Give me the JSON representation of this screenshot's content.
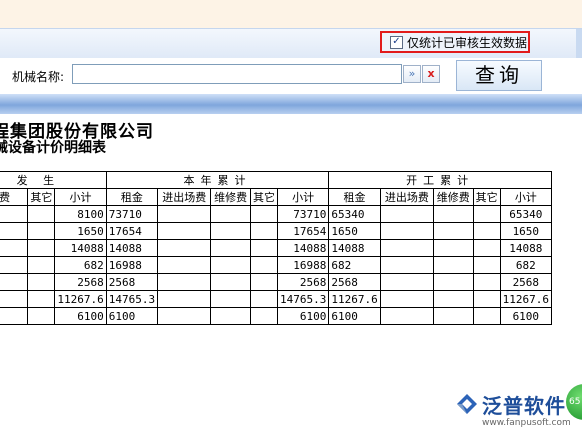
{
  "filter": {
    "verified_only_label": "仅统计已审核生效数据",
    "verified_only_checked": true,
    "machine_name_label": "机械名称:",
    "machine_name_value": "",
    "more_button": "»",
    "clear_button": "x",
    "query_button": "查询"
  },
  "report": {
    "company_title": "程集团股份有限公司",
    "report_title": "械设备计价明细表",
    "groups": {
      "current": "发 生",
      "year": "本年累计",
      "start": "开工累计"
    },
    "columns": {
      "repair": "修费",
      "other": "其它",
      "subtotal": "小计",
      "rent": "租金",
      "in_out": "进出场费",
      "repair_fee": "维修费"
    },
    "rows": [
      {
        "cur_subtotal": "8100",
        "year_rent": "73710",
        "year_subtotal": "73710",
        "start_rent": "65340",
        "start_subtotal": "65340"
      },
      {
        "cur_subtotal": "1650",
        "year_rent": "17654",
        "year_subtotal": "17654",
        "start_rent": "1650",
        "start_subtotal": "1650"
      },
      {
        "cur_subtotal": "14088",
        "year_rent": "14088",
        "year_subtotal": "14088",
        "start_rent": "14088",
        "start_subtotal": "14088"
      },
      {
        "cur_subtotal": "682",
        "year_rent": "16988",
        "year_subtotal": "16988",
        "start_rent": "682",
        "start_subtotal": "682"
      },
      {
        "cur_subtotal": "2568",
        "year_rent": "2568",
        "year_subtotal": "2568",
        "start_rent": "2568",
        "start_subtotal": "2568"
      },
      {
        "cur_subtotal": "11267.6",
        "year_rent": "14765.3",
        "year_subtotal": "14765.3",
        "start_rent": "11267.6",
        "start_subtotal": "11267.6"
      },
      {
        "cur_subtotal": "6100",
        "year_rent": "6100",
        "year_subtotal": "6100",
        "start_rent": "6100",
        "start_subtotal": "6100"
      }
    ]
  },
  "branding": {
    "logo_name": "泛普软件",
    "logo_url": "www.fanpusoft.com",
    "badge_text": "65"
  },
  "colors": {
    "highlight_border": "#e21b1b",
    "toolbar_blue": "#7fa6dc",
    "brand_blue": "#1e4e9a"
  }
}
